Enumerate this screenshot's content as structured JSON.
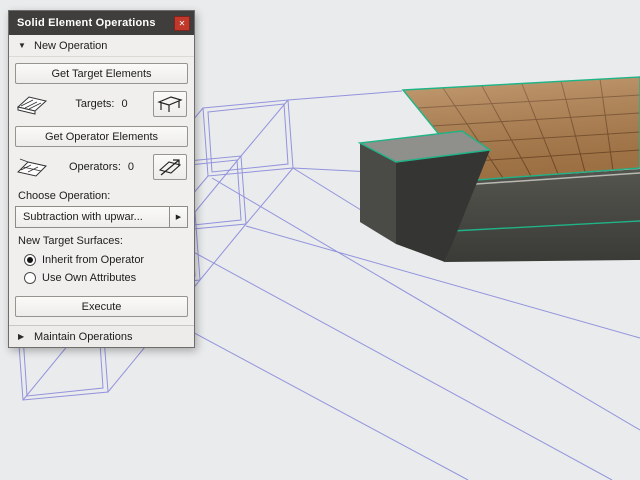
{
  "window": {
    "title": "Solid Element Operations",
    "close_glyph": "✕"
  },
  "icons": {
    "expand_down": "▼",
    "expand_right": "▶",
    "dropdown_arrow": "▶"
  },
  "sections": {
    "new_operation": "New Operation",
    "maintain_operations": "Maintain Operations"
  },
  "buttons": {
    "get_targets": "Get Target Elements",
    "get_operators": "Get Operator Elements",
    "execute": "Execute"
  },
  "counters": {
    "targets_label": "Targets:",
    "targets_value": "0",
    "operators_label": "Operators:",
    "operators_value": "0"
  },
  "labels": {
    "choose_operation": "Choose Operation:",
    "new_target_surfaces": "New Target Surfaces:"
  },
  "dropdown": {
    "selected": "Subtraction with upwar..."
  },
  "radios": [
    {
      "label": "Inherit from Operator",
      "checked": true
    },
    {
      "label": "Use Own Attributes",
      "checked": false
    }
  ],
  "colors": {
    "wireframe": "#9393dd",
    "selection": "#1fb487",
    "tile": "#b5824d",
    "grout": "#80522c",
    "concrete_dark": "#454543",
    "concrete_darker": "#353533",
    "concrete_mid": "#8f8f8b",
    "viewport_bg": "#e9ebec",
    "titlebar": "#3f3e3c",
    "close_red": "#c0392b"
  }
}
